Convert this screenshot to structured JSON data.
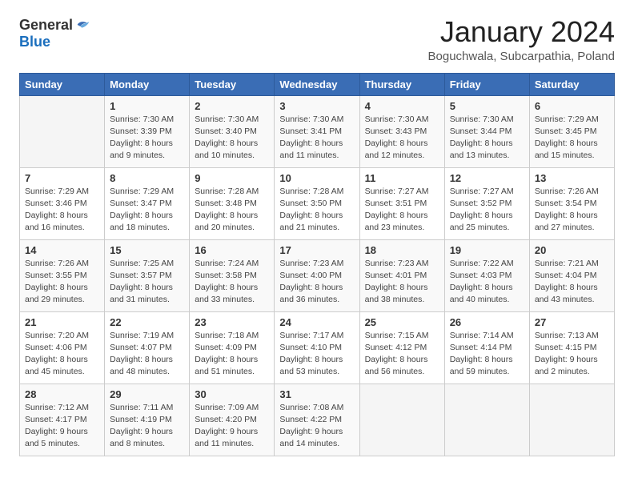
{
  "header": {
    "logo_general": "General",
    "logo_blue": "Blue",
    "month_title": "January 2024",
    "subtitle": "Boguchwala, Subcarpathia, Poland"
  },
  "weekdays": [
    "Sunday",
    "Monday",
    "Tuesday",
    "Wednesday",
    "Thursday",
    "Friday",
    "Saturday"
  ],
  "weeks": [
    [
      {
        "day": "",
        "info": ""
      },
      {
        "day": "1",
        "info": "Sunrise: 7:30 AM\nSunset: 3:39 PM\nDaylight: 8 hours\nand 9 minutes."
      },
      {
        "day": "2",
        "info": "Sunrise: 7:30 AM\nSunset: 3:40 PM\nDaylight: 8 hours\nand 10 minutes."
      },
      {
        "day": "3",
        "info": "Sunrise: 7:30 AM\nSunset: 3:41 PM\nDaylight: 8 hours\nand 11 minutes."
      },
      {
        "day": "4",
        "info": "Sunrise: 7:30 AM\nSunset: 3:43 PM\nDaylight: 8 hours\nand 12 minutes."
      },
      {
        "day": "5",
        "info": "Sunrise: 7:30 AM\nSunset: 3:44 PM\nDaylight: 8 hours\nand 13 minutes."
      },
      {
        "day": "6",
        "info": "Sunrise: 7:29 AM\nSunset: 3:45 PM\nDaylight: 8 hours\nand 15 minutes."
      }
    ],
    [
      {
        "day": "7",
        "info": "Sunrise: 7:29 AM\nSunset: 3:46 PM\nDaylight: 8 hours\nand 16 minutes."
      },
      {
        "day": "8",
        "info": "Sunrise: 7:29 AM\nSunset: 3:47 PM\nDaylight: 8 hours\nand 18 minutes."
      },
      {
        "day": "9",
        "info": "Sunrise: 7:28 AM\nSunset: 3:48 PM\nDaylight: 8 hours\nand 20 minutes."
      },
      {
        "day": "10",
        "info": "Sunrise: 7:28 AM\nSunset: 3:50 PM\nDaylight: 8 hours\nand 21 minutes."
      },
      {
        "day": "11",
        "info": "Sunrise: 7:27 AM\nSunset: 3:51 PM\nDaylight: 8 hours\nand 23 minutes."
      },
      {
        "day": "12",
        "info": "Sunrise: 7:27 AM\nSunset: 3:52 PM\nDaylight: 8 hours\nand 25 minutes."
      },
      {
        "day": "13",
        "info": "Sunrise: 7:26 AM\nSunset: 3:54 PM\nDaylight: 8 hours\nand 27 minutes."
      }
    ],
    [
      {
        "day": "14",
        "info": "Sunrise: 7:26 AM\nSunset: 3:55 PM\nDaylight: 8 hours\nand 29 minutes."
      },
      {
        "day": "15",
        "info": "Sunrise: 7:25 AM\nSunset: 3:57 PM\nDaylight: 8 hours\nand 31 minutes."
      },
      {
        "day": "16",
        "info": "Sunrise: 7:24 AM\nSunset: 3:58 PM\nDaylight: 8 hours\nand 33 minutes."
      },
      {
        "day": "17",
        "info": "Sunrise: 7:23 AM\nSunset: 4:00 PM\nDaylight: 8 hours\nand 36 minutes."
      },
      {
        "day": "18",
        "info": "Sunrise: 7:23 AM\nSunset: 4:01 PM\nDaylight: 8 hours\nand 38 minutes."
      },
      {
        "day": "19",
        "info": "Sunrise: 7:22 AM\nSunset: 4:03 PM\nDaylight: 8 hours\nand 40 minutes."
      },
      {
        "day": "20",
        "info": "Sunrise: 7:21 AM\nSunset: 4:04 PM\nDaylight: 8 hours\nand 43 minutes."
      }
    ],
    [
      {
        "day": "21",
        "info": "Sunrise: 7:20 AM\nSunset: 4:06 PM\nDaylight: 8 hours\nand 45 minutes."
      },
      {
        "day": "22",
        "info": "Sunrise: 7:19 AM\nSunset: 4:07 PM\nDaylight: 8 hours\nand 48 minutes."
      },
      {
        "day": "23",
        "info": "Sunrise: 7:18 AM\nSunset: 4:09 PM\nDaylight: 8 hours\nand 51 minutes."
      },
      {
        "day": "24",
        "info": "Sunrise: 7:17 AM\nSunset: 4:10 PM\nDaylight: 8 hours\nand 53 minutes."
      },
      {
        "day": "25",
        "info": "Sunrise: 7:15 AM\nSunset: 4:12 PM\nDaylight: 8 hours\nand 56 minutes."
      },
      {
        "day": "26",
        "info": "Sunrise: 7:14 AM\nSunset: 4:14 PM\nDaylight: 8 hours\nand 59 minutes."
      },
      {
        "day": "27",
        "info": "Sunrise: 7:13 AM\nSunset: 4:15 PM\nDaylight: 9 hours\nand 2 minutes."
      }
    ],
    [
      {
        "day": "28",
        "info": "Sunrise: 7:12 AM\nSunset: 4:17 PM\nDaylight: 9 hours\nand 5 minutes."
      },
      {
        "day": "29",
        "info": "Sunrise: 7:11 AM\nSunset: 4:19 PM\nDaylight: 9 hours\nand 8 minutes."
      },
      {
        "day": "30",
        "info": "Sunrise: 7:09 AM\nSunset: 4:20 PM\nDaylight: 9 hours\nand 11 minutes."
      },
      {
        "day": "31",
        "info": "Sunrise: 7:08 AM\nSunset: 4:22 PM\nDaylight: 9 hours\nand 14 minutes."
      },
      {
        "day": "",
        "info": ""
      },
      {
        "day": "",
        "info": ""
      },
      {
        "day": "",
        "info": ""
      }
    ]
  ]
}
